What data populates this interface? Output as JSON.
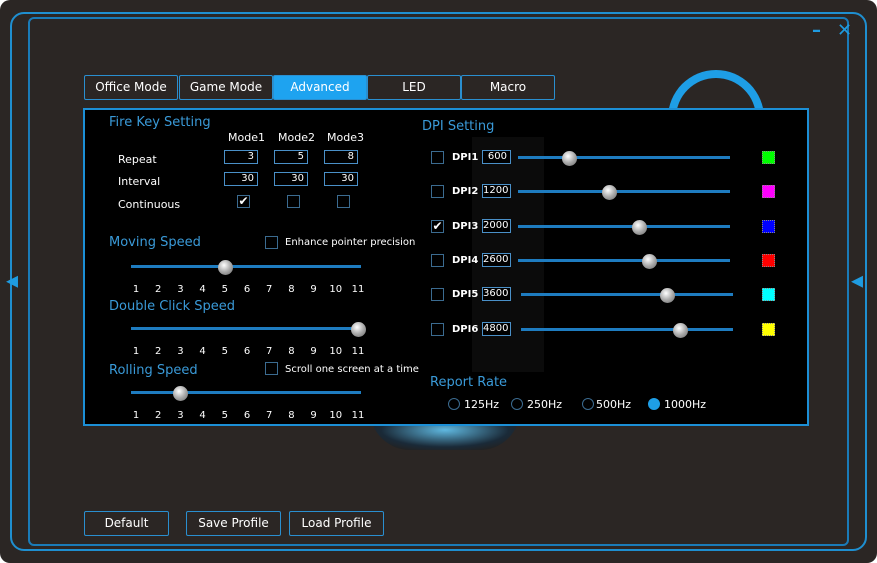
{
  "window": {
    "minimize_icon": "minimize-icon",
    "close_icon": "close-icon"
  },
  "tabs": [
    {
      "label": "Office Mode"
    },
    {
      "label": "Game Mode"
    },
    {
      "label": "Advanced",
      "active": true
    },
    {
      "label": "LED"
    },
    {
      "label": "Macro"
    }
  ],
  "fire_key": {
    "title": "Fire Key Setting",
    "modes": [
      "Mode1",
      "Mode2",
      "Mode3"
    ],
    "rows": {
      "repeat_label": "Repeat",
      "repeat": [
        "3",
        "5",
        "8"
      ],
      "interval_label": "Interval",
      "interval": [
        "30",
        "30",
        "30"
      ],
      "continuous_label": "Continuous",
      "continuous": [
        true,
        false,
        false
      ]
    }
  },
  "moving_speed": {
    "title": "Moving Speed",
    "enhance_label": "Enhance pointer precision",
    "enhance": false,
    "value": 5
  },
  "double_click": {
    "title": "Double Click Speed",
    "value": 11
  },
  "rolling": {
    "title": "Rolling Speed",
    "scroll_label": "Scroll one screen at a time",
    "scroll": false,
    "value": 3
  },
  "ticks": [
    "1",
    "2",
    "3",
    "4",
    "5",
    "6",
    "7",
    "8",
    "9",
    "10",
    "11"
  ],
  "dpi": {
    "title": "DPI Setting",
    "rows": [
      {
        "label": "DPI1",
        "value": "600",
        "checked": false,
        "level": 0.24,
        "color": "#00ff00"
      },
      {
        "label": "DPI2",
        "value": "1200",
        "checked": false,
        "level": 0.43,
        "color": "#ff00ff"
      },
      {
        "label": "DPI3",
        "value": "2000",
        "checked": true,
        "level": 0.57,
        "color": "#0000ff"
      },
      {
        "label": "DPI4",
        "value": "2600",
        "checked": false,
        "level": 0.62,
        "color": "#ff0000"
      },
      {
        "label": "DPI5",
        "value": "3600",
        "checked": false,
        "level": 0.69,
        "color": "#00ffff"
      },
      {
        "label": "DPI6",
        "value": "4800",
        "checked": false,
        "level": 0.75,
        "color": "#ffff00"
      }
    ]
  },
  "report_rate": {
    "title": "Report Rate",
    "options": [
      "125Hz",
      "250Hz",
      "500Hz",
      "1000Hz"
    ],
    "selected": 3
  },
  "buttons": {
    "default": "Default",
    "save": "Save Profile",
    "load": "Load Profile"
  }
}
